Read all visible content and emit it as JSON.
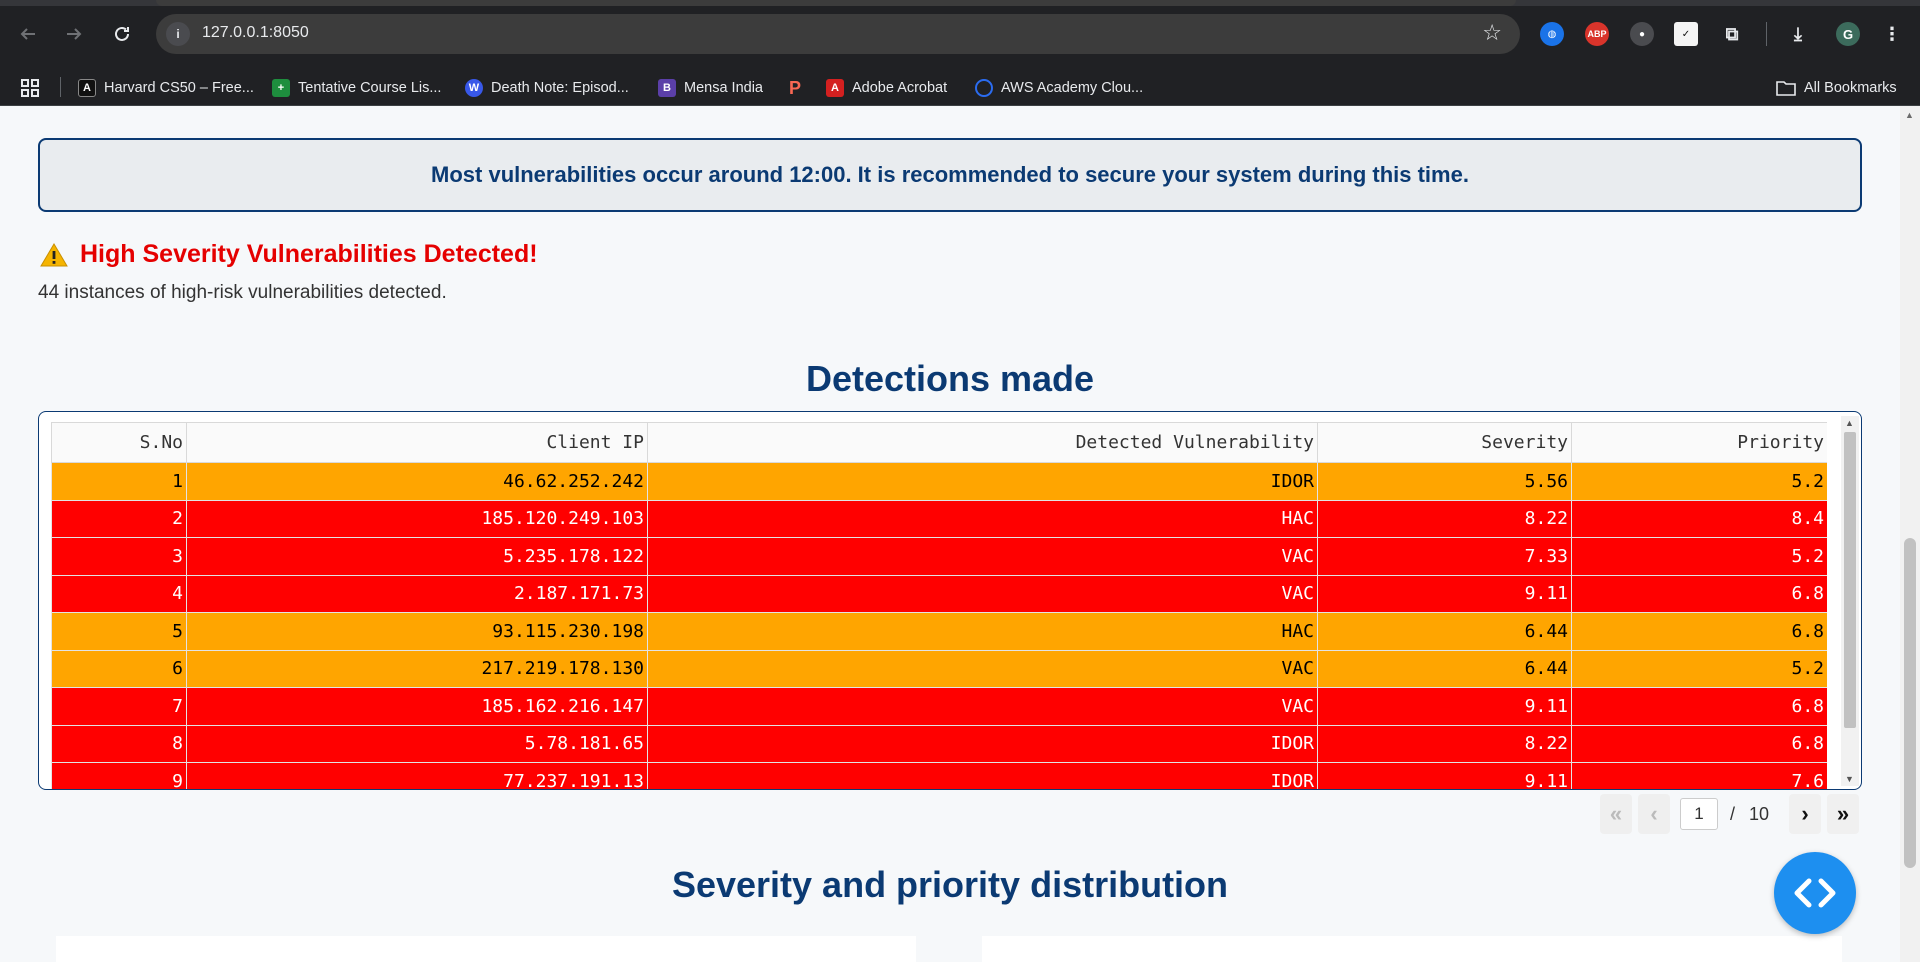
{
  "browser": {
    "url": "127.0.0.1:8050",
    "profile_initial": "G",
    "ext_abp": "ABP",
    "bookmarks": [
      {
        "label": "Harvard CS50 – Free...",
        "icon": "cs50-icon",
        "color": "#111111",
        "glyph": "A"
      },
      {
        "label": "Tentative Course Lis...",
        "icon": "sheets-icon",
        "color": "#1e8e3e",
        "glyph": "+"
      },
      {
        "label": "Death Note: Episod...",
        "icon": "wordpress-icon",
        "color": "#3858e9",
        "glyph": "W"
      },
      {
        "label": "Mensa India",
        "icon": "mensa-icon",
        "color": "#5b3fa8",
        "glyph": "B"
      },
      {
        "label": "Adobe Acrobat",
        "icon": "acrobat-icon",
        "color": "#d42020",
        "glyph": "A"
      },
      {
        "label": "AWS Academy Clou...",
        "icon": "aws-academy-icon",
        "color": "#2b6cf0",
        "glyph": "Q"
      }
    ],
    "all_bookmarks": "All Bookmarks"
  },
  "banner": {
    "text": "Most vulnerabilities occur around 12:00. It is recommended to secure your system during this time."
  },
  "alert": {
    "title": "High Severity Vulnerabilities Detected!",
    "text": "44 instances of high-risk vulnerabilities detected."
  },
  "detections": {
    "title": "Detections made",
    "columns": [
      "S.No",
      "Client IP",
      "Detected Vulnerability",
      "Severity",
      "Priority"
    ],
    "rows": [
      {
        "sno": "1",
        "ip": "46.62.252.242",
        "vuln": "IDOR",
        "severity": "5.56",
        "priority": "5.2",
        "level": "medium"
      },
      {
        "sno": "2",
        "ip": "185.120.249.103",
        "vuln": "HAC",
        "severity": "8.22",
        "priority": "8.4",
        "level": "high"
      },
      {
        "sno": "3",
        "ip": "5.235.178.122",
        "vuln": "VAC",
        "severity": "7.33",
        "priority": "5.2",
        "level": "high"
      },
      {
        "sno": "4",
        "ip": "2.187.171.73",
        "vuln": "VAC",
        "severity": "9.11",
        "priority": "6.8",
        "level": "high"
      },
      {
        "sno": "5",
        "ip": "93.115.230.198",
        "vuln": "HAC",
        "severity": "6.44",
        "priority": "6.8",
        "level": "medium"
      },
      {
        "sno": "6",
        "ip": "217.219.178.130",
        "vuln": "VAC",
        "severity": "6.44",
        "priority": "5.2",
        "level": "medium"
      },
      {
        "sno": "7",
        "ip": "185.162.216.147",
        "vuln": "VAC",
        "severity": "9.11",
        "priority": "6.8",
        "level": "high"
      },
      {
        "sno": "8",
        "ip": "5.78.181.65",
        "vuln": "IDOR",
        "severity": "8.22",
        "priority": "6.8",
        "level": "high"
      },
      {
        "sno": "9",
        "ip": "77.237.191.13",
        "vuln": "IDOR",
        "severity": "9.11",
        "priority": "7.6",
        "level": "high"
      }
    ],
    "pagination": {
      "current": "1",
      "separator": "/",
      "total": "10"
    }
  },
  "distribution": {
    "title": "Severity and priority distribution"
  },
  "colors": {
    "high": "#ff0000",
    "medium": "#ffa500",
    "accent": "#0b3a73",
    "fab": "#1d8ff0"
  }
}
